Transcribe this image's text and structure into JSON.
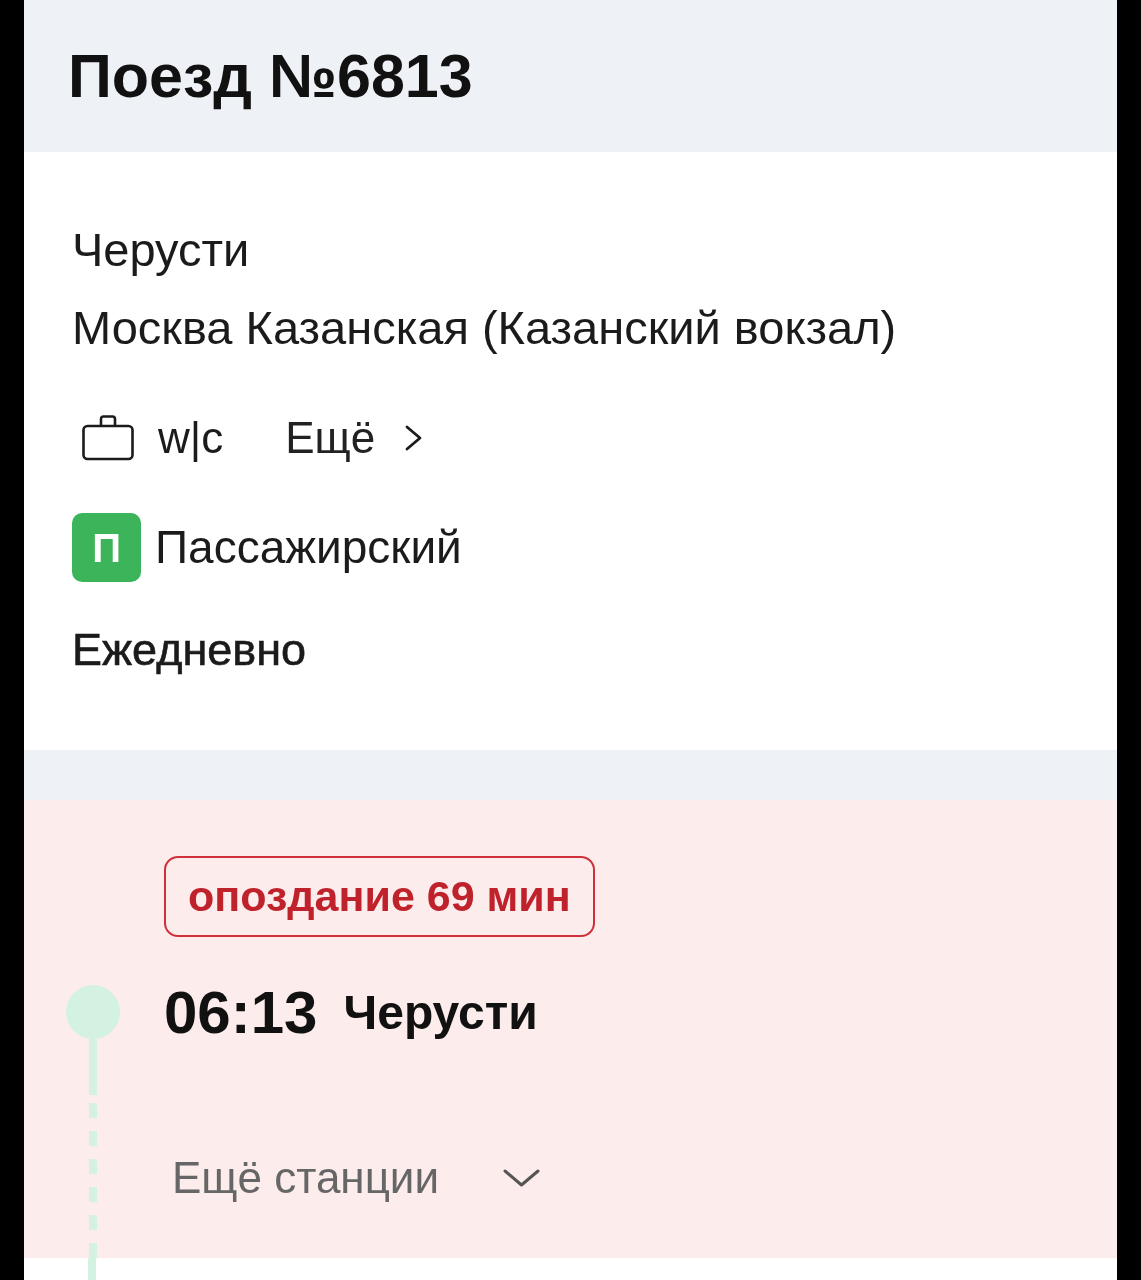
{
  "header": {
    "title": "Поезд №6813"
  },
  "train": {
    "route": [
      "Черусти",
      "Москва Казанская (Казанский вокзал)"
    ],
    "amenities": {
      "wc": "w|c",
      "more": "Ещё"
    },
    "category": {
      "badge": "П",
      "label": "Пассажирский"
    },
    "schedule": "Ежедневно"
  },
  "stops": [
    {
      "delay": "опоздание 69 мин",
      "time": "06:13",
      "station": "Черусти"
    }
  ],
  "more_stations": {
    "label": "Ещё станции",
    "expanded": false
  }
}
